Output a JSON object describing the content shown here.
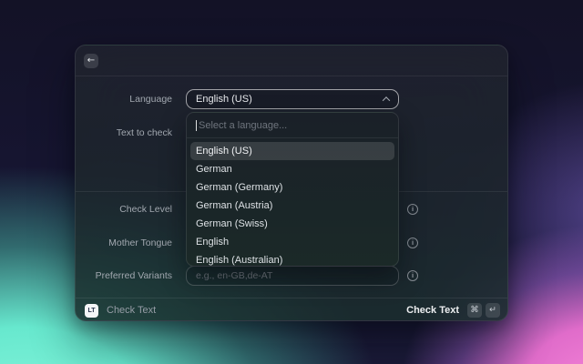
{
  "window": {
    "header": {
      "back_icon": "←"
    },
    "form": {
      "language": {
        "label": "Language",
        "value": "English (US)"
      },
      "text_to_check": {
        "label": "Text to check"
      },
      "check_level": {
        "label": "Check Level"
      },
      "mother_tongue": {
        "label": "Mother Tongue"
      },
      "preferred_variants": {
        "label": "Preferred Variants",
        "placeholder": "e.g., en-GB,de-AT"
      }
    },
    "language_dropdown": {
      "search_placeholder": "Select a language...",
      "options": [
        {
          "label": "English (US)",
          "selected": true
        },
        {
          "label": "German",
          "selected": false
        },
        {
          "label": "German (Germany)",
          "selected": false
        },
        {
          "label": "German (Austria)",
          "selected": false
        },
        {
          "label": "German (Swiss)",
          "selected": false
        },
        {
          "label": "English",
          "selected": false
        },
        {
          "label": "English (Australian)",
          "selected": false
        }
      ]
    },
    "footer": {
      "app_icon_text": "LT",
      "left_label": "Check Text",
      "action_label": "Check Text",
      "shortcut_keys": [
        "⌘",
        "↵"
      ]
    },
    "icons": {
      "info": "i"
    }
  },
  "colors": {
    "background_mint": "#84f4da",
    "background_pink": "#f584d8",
    "background_purple": "#7e64cb",
    "background_navy": "#15152a",
    "selected_row": "rgba(255,255,255,0.13)"
  }
}
